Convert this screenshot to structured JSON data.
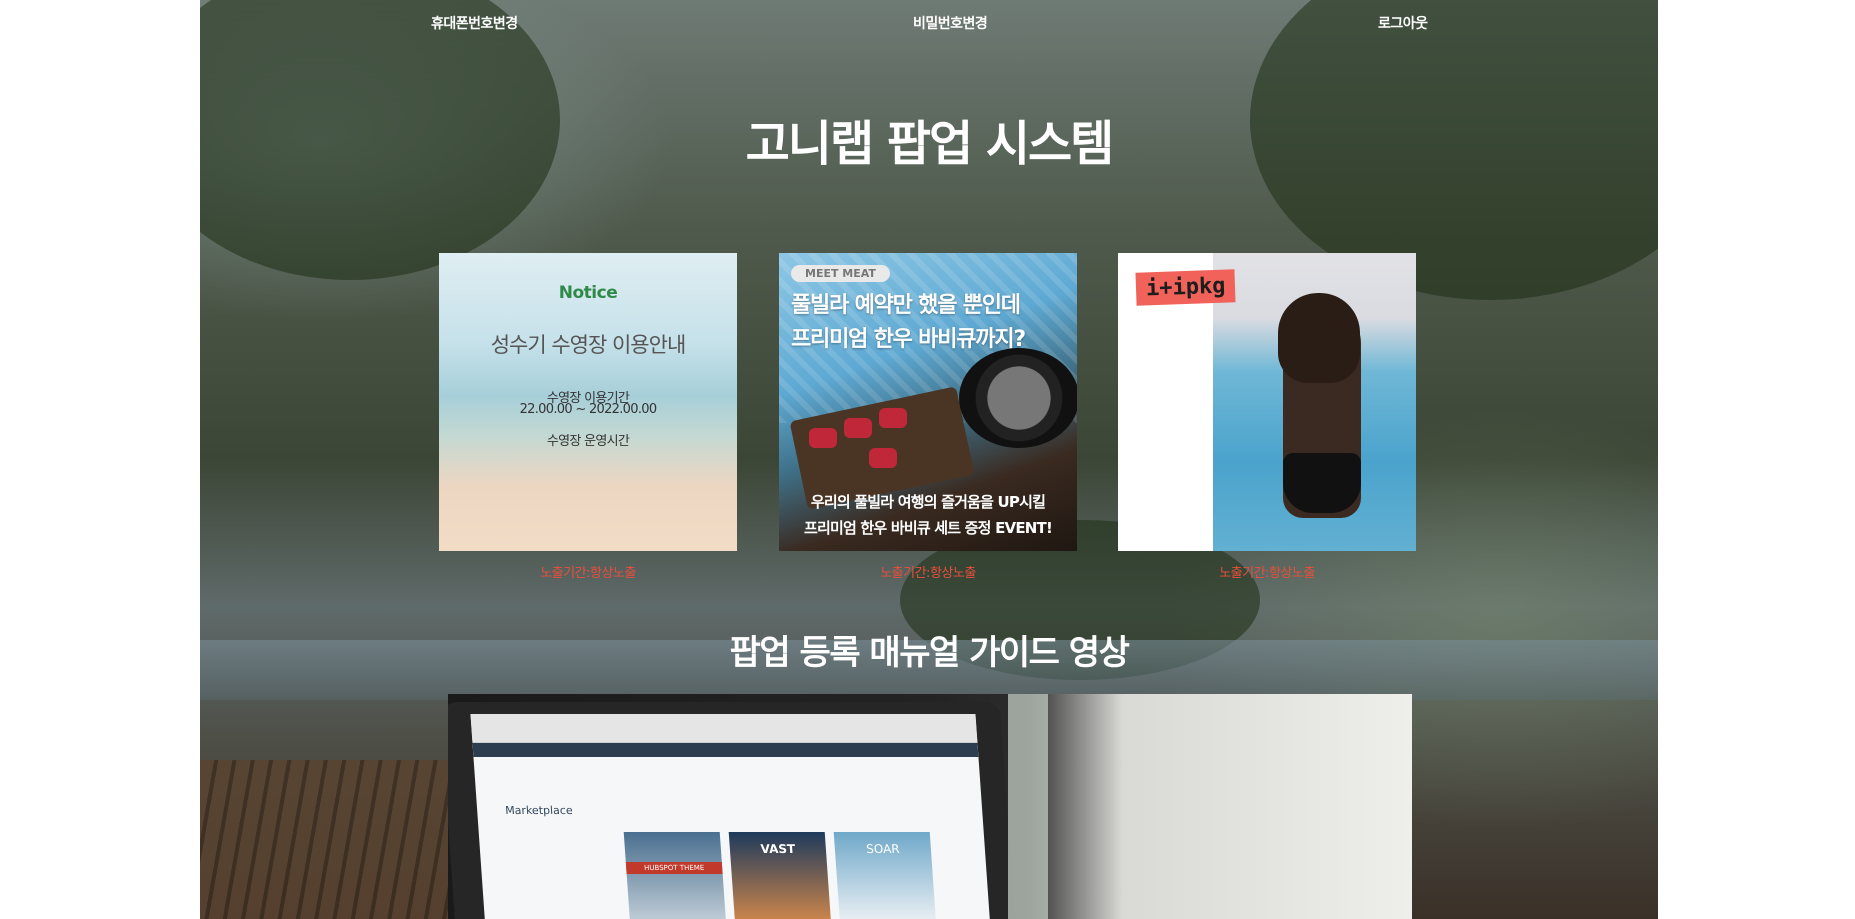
{
  "nav": {
    "change_phone": "휴대폰번호변경",
    "change_password": "비밀번호변경",
    "logout": "로그아웃"
  },
  "page_title": "고니랩 팝업 시스템",
  "popups": [
    {
      "heading": "Notice",
      "title": "성수기 수영장 이용안내",
      "period_label": "수영장 이용기간",
      "period_value": "22.00.00 ~ 2022.00.00",
      "hours_label": "수영장 운영시간",
      "caption": "노출기간:항상노출"
    },
    {
      "tag": "MEET MEAT",
      "headline_1": "풀빌라 예약만 했을 뿐인데",
      "headline_2": "프리미엄 한우 바비큐까지?",
      "bottom_1": "우리의 풀빌라 여행의 즐거움을 UP시킬",
      "bottom_2": "프리미엄 한우 바비큐 세트 증정 EVENT!",
      "caption": "노출기간:항상노출"
    },
    {
      "logo": "i+ipkg",
      "caption": "노출기간:항상노출"
    }
  ],
  "guide_title": "팝업 등록 매뉴얼 가이드 영상",
  "video": {
    "marketplace_label": "Marketplace",
    "theme_1": "HUBSPOT THEME",
    "theme_2": "VAST",
    "theme_3": "SOAR"
  },
  "colors": {
    "caption": "#e8503a",
    "notice_green": "#2f8a4a",
    "text_white": "#ffffff"
  }
}
